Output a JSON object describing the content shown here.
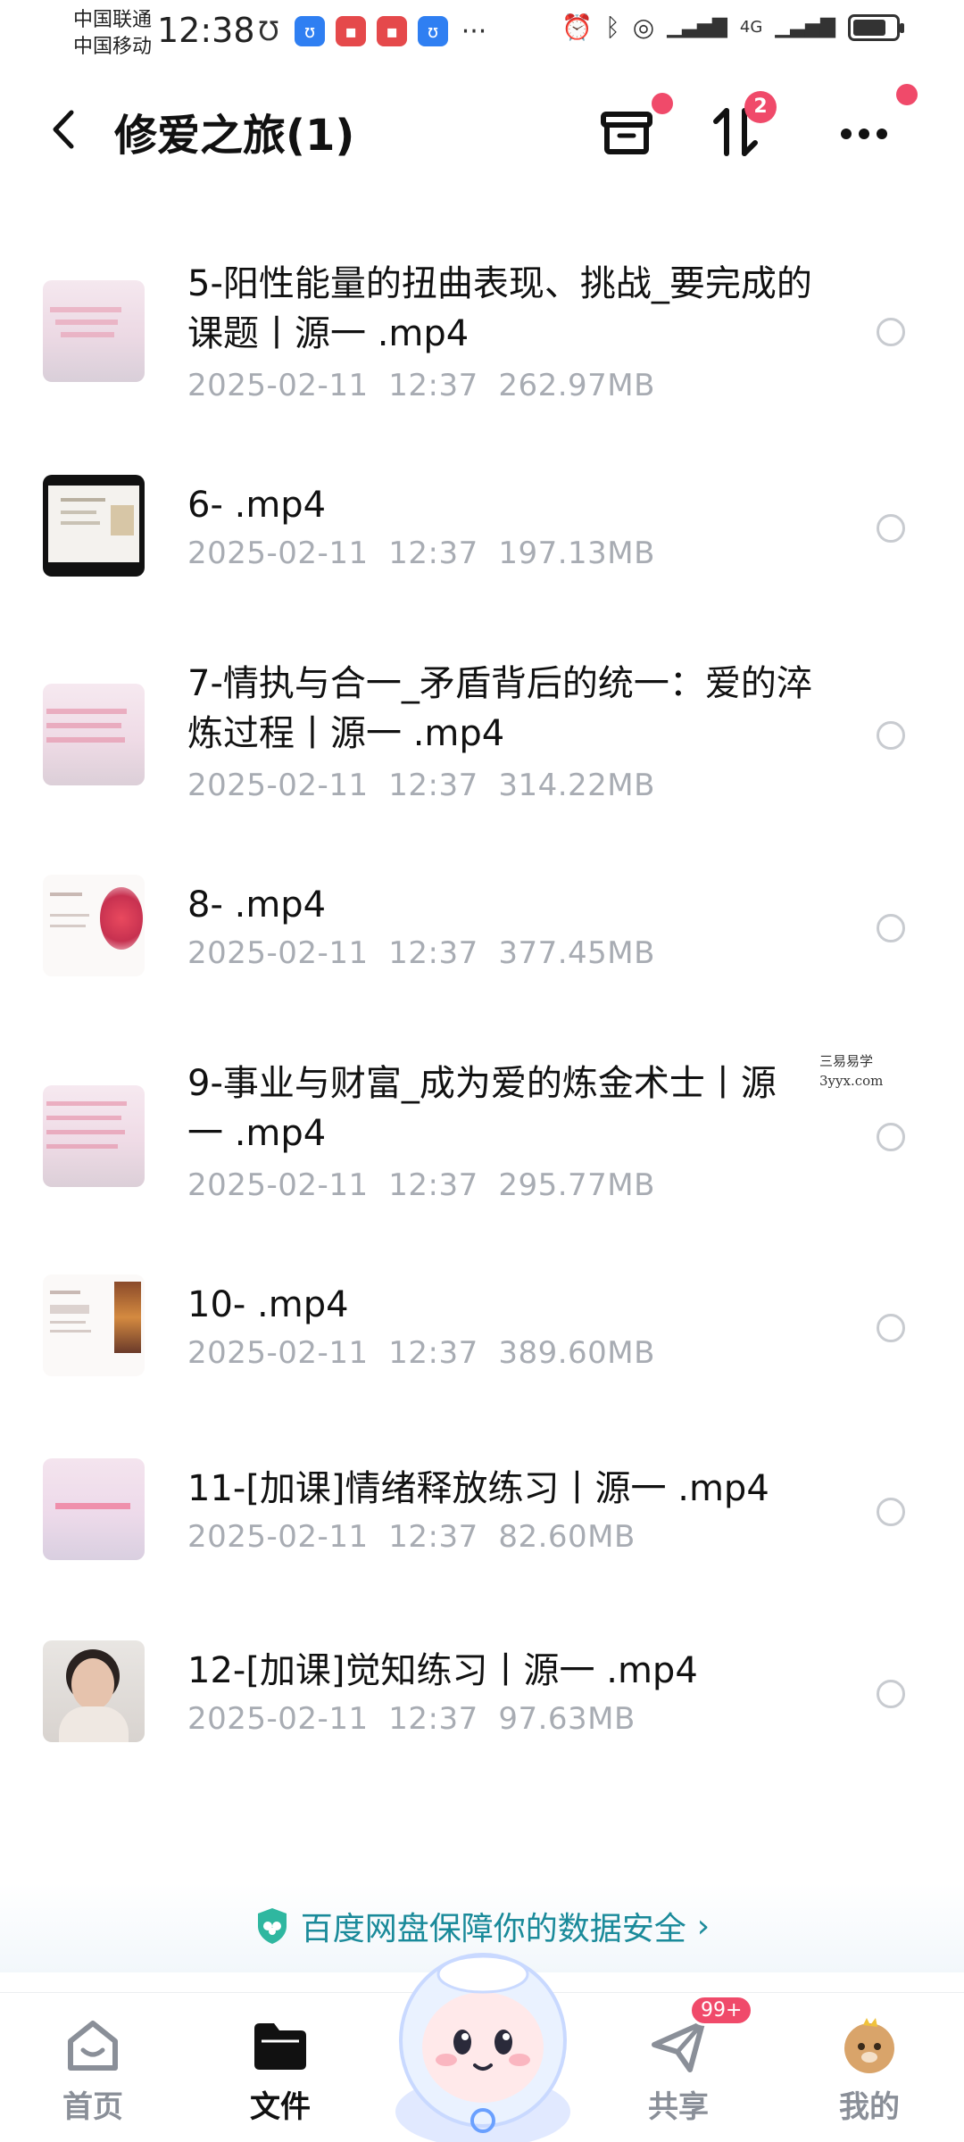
{
  "status_bar": {
    "carrier1": "中国联通",
    "carrier2": "中国移动",
    "time": "12:38",
    "network": "4G"
  },
  "header": {
    "title": "修爱之旅(1)",
    "sort_badge": "2"
  },
  "files": [
    {
      "name": "5-阳性能量的扭曲表现、挑战_要完成的课题丨源一 .mp4",
      "date": "2025-02-11",
      "time": "12:37",
      "size": "262.97MB"
    },
    {
      "name": "6- .mp4",
      "date": "2025-02-11",
      "time": "12:37",
      "size": "197.13MB"
    },
    {
      "name": "7-情执与合一_矛盾背后的统一：爱的淬炼过程丨源一 .mp4",
      "date": "2025-02-11",
      "time": "12:37",
      "size": "314.22MB"
    },
    {
      "name": "8- .mp4",
      "date": "2025-02-11",
      "time": "12:37",
      "size": "377.45MB"
    },
    {
      "name": "9-事业与财富_成为爱的炼金术士丨源一 .mp4",
      "date": "2025-02-11",
      "time": "12:37",
      "size": "295.77MB"
    },
    {
      "name": "10- .mp4",
      "date": "2025-02-11",
      "time": "12:37",
      "size": "389.60MB"
    },
    {
      "name": "11-[加课]情绪释放练习丨源一 .mp4",
      "date": "2025-02-11",
      "time": "12:37",
      "size": "82.60MB"
    },
    {
      "name": "12-[加课]觉知练习丨源一 .mp4",
      "date": "2025-02-11",
      "time": "12:37",
      "size": "97.63MB"
    }
  ],
  "watermark": {
    "line1": "三易易学",
    "line2": "3yyx.com"
  },
  "security_banner": {
    "text": "百度网盘保障你的数据安全"
  },
  "nav": {
    "home": "首页",
    "files": "文件",
    "share": "共享",
    "share_badge": "99+",
    "mine": "我的"
  },
  "colors": {
    "accent_badge": "#f04a6a",
    "security_text": "#1a8a9a",
    "meta_gray": "#a8acb3"
  }
}
